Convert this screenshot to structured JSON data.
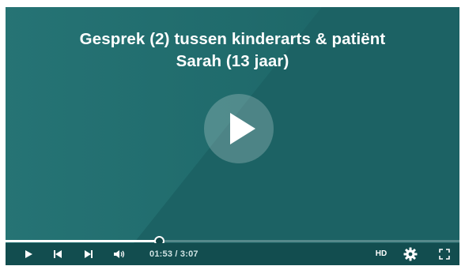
{
  "video": {
    "title_line1": "Gesprek (2) tussen kinderarts & patiënt",
    "title_line2": "Sarah (13 jaar)",
    "poster_color": "#1f6a6b"
  },
  "controls": {
    "play_icon": "play-icon",
    "prev_icon": "skip-back-icon",
    "next_icon": "skip-forward-icon",
    "volume_icon": "volume-icon",
    "time_display": "01:53 / 3:07",
    "hd_label": "HD",
    "settings_icon": "gear-icon",
    "fullscreen_icon": "fullscreen-icon",
    "bar_color": "#124d4f"
  },
  "progress": {
    "elapsed_fraction": 0.3376,
    "current": "01:53",
    "duration": "3:07"
  }
}
